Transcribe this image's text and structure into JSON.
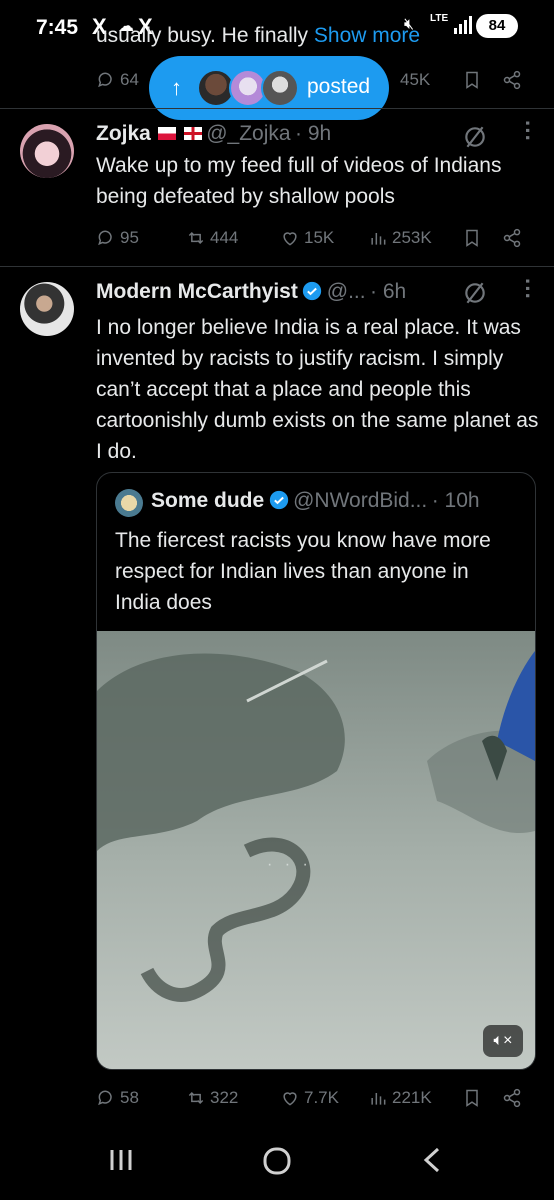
{
  "status_bar": {
    "time": "7:45",
    "app_icon_1": "X",
    "app_icon_2": "X",
    "network": "LTE",
    "battery": "84",
    "icons": [
      "x-logo-icon",
      "cloud-icon",
      "mute-icon",
      "signal-icon",
      "battery-icon"
    ]
  },
  "prev_tweet": {
    "partial_text": "usually busy. He finally",
    "show_more": "Show more",
    "replies": "64",
    "views": "45K"
  },
  "new_posts_pill": {
    "label": "posted",
    "accent": "#1d9bf0"
  },
  "tweet1": {
    "name": "Zojka",
    "handle": "@_Zojka",
    "time": "· 9h",
    "text": "Wake up to my feed full of videos of Indians being defeated by shallow pools",
    "replies": "95",
    "reposts": "444",
    "likes": "15K",
    "views": "253K"
  },
  "tweet2": {
    "name": "Modern McCarthyist",
    "handle": "@...",
    "time": "· 6h",
    "text": "I no longer believe India is a real place. It was invented by racists to justify racism. I simply can’t accept that a place and people this cartoonishly dumb exists on the same planet as I do.",
    "replies": "58",
    "reposts": "322",
    "likes": "7.7K",
    "views": "221K"
  },
  "quoted": {
    "name": "Some dude",
    "handle": "@NWordBid...",
    "time": "· 10h",
    "text": "The fiercest racists you know have more respect for Indian lives than anyone in India does"
  },
  "colors": {
    "background": "#000000",
    "text": "#e7e9ea",
    "muted": "#71767b",
    "accent": "#1d9bf0"
  }
}
